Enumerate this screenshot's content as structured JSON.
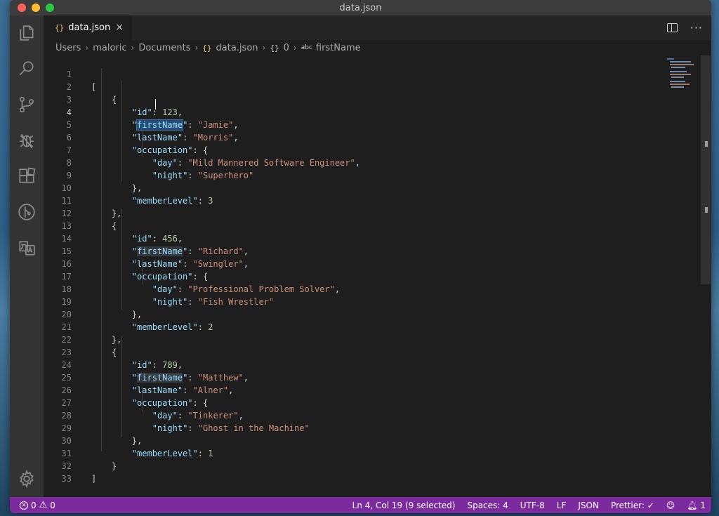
{
  "window": {
    "title": "data.json"
  },
  "tab": {
    "icon_text": "{}",
    "label": "data.json",
    "close_icon": "×"
  },
  "tab_actions": {
    "split_icon": "split-editor-icon",
    "more_label": "···"
  },
  "breadcrumb": {
    "items": [
      "Users",
      "maloric",
      "Documents"
    ],
    "file_icon": "{}",
    "file": "data.json",
    "node_icon": "{}",
    "node": "0",
    "symbol_icon": "abc",
    "symbol": "firstName"
  },
  "activity_bar": {
    "icons": [
      "explorer-icon",
      "search-icon",
      "source-control-icon",
      "debug-icon",
      "extensions-icon",
      "git-graph-icon",
      "translate-icon",
      "settings-gear-icon"
    ]
  },
  "editor": {
    "line_numbers": [
      "1",
      "2",
      "3",
      "4",
      "5",
      "6",
      "7",
      "8",
      "9",
      "10",
      "11",
      "12",
      "13",
      "14",
      "15",
      "16",
      "17",
      "18",
      "19",
      "20",
      "21",
      "22",
      "23",
      "24",
      "25",
      "26",
      "27",
      "28",
      "29",
      "30",
      "31",
      "32",
      "33"
    ],
    "active_line": "4",
    "records": [
      {
        "id": "123",
        "firstName": "Jamie",
        "lastName": "Morris",
        "day": "Mild Mannered Software Engineer",
        "night": "Superhero",
        "memberLevel": "3"
      },
      {
        "id": "456",
        "firstName": "Richard",
        "lastName": "Swingler",
        "day": "Professional Problem Solver",
        "night": "Fish Wrestler",
        "memberLevel": "2"
      },
      {
        "id": "789",
        "firstName": "Matthew",
        "lastName": "Alner",
        "day": "Tinkerer",
        "night": "Ghost in the Machine",
        "memberLevel": "1"
      }
    ],
    "keys": {
      "id": "id",
      "firstName": "firstName",
      "lastName": "lastName",
      "occupation": "occupation",
      "day": "day",
      "night": "night",
      "memberLevel": "memberLevel"
    }
  },
  "statusbar": {
    "errors": "0",
    "warnings": "0",
    "position": "Ln 4, Col 19 (9 selected)",
    "spaces": "Spaces: 4",
    "encoding": "UTF-8",
    "eol": "LF",
    "language": "JSON",
    "prettier": "Prettier: ✓",
    "feedback_icon": "smiley-icon",
    "notifications": "1"
  },
  "colors": {
    "statusbar": "#7b2b9e",
    "selection": "#264f78",
    "key": "#9cdcfe",
    "string": "#ce9178",
    "number": "#b5cea8"
  }
}
